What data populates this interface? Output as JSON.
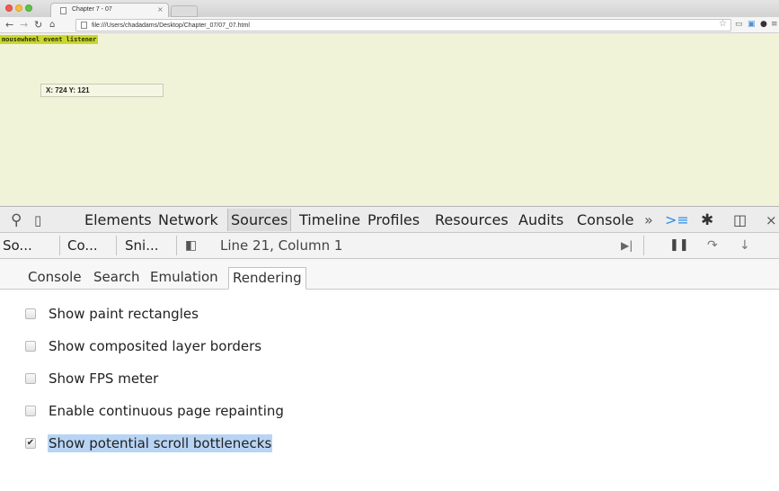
{
  "browser": {
    "tab_title": "Chapter 7 - 07",
    "tab_close": "×",
    "url": "file:///Users/chadadams/Desktop/Chapter_07/07_07.html"
  },
  "page": {
    "event_label": "mousewheel event listener",
    "coords_text": "X: 724 Y: 121"
  },
  "devtools": {
    "tabs": [
      "Elements",
      "Network",
      "Sources",
      "Timeline",
      "Profiles",
      "Resources",
      "Audits",
      "Console"
    ],
    "active_tab": "Sources",
    "more": "»",
    "close": "×",
    "source_tabs": [
      "So...",
      "Co...",
      "Sni..."
    ],
    "location": "Line 21, Column 1",
    "drawer_tabs": [
      "Console",
      "Search",
      "Emulation",
      "Rendering"
    ],
    "active_drawer_tab": "Rendering",
    "rendering_options": [
      {
        "label": "Show paint rectangles",
        "checked": false
      },
      {
        "label": "Show composited layer borders",
        "checked": false
      },
      {
        "label": "Show FPS meter",
        "checked": false
      },
      {
        "label": "Enable continuous page repainting",
        "checked": false
      },
      {
        "label": "Show potential scroll bottlenecks",
        "checked": true
      }
    ]
  },
  "colors": {
    "page_background": "#f1f3d9",
    "label_highlight": "#c9d72d",
    "selection": "#b8d4f4",
    "console_icon": "#2c8ee8"
  }
}
